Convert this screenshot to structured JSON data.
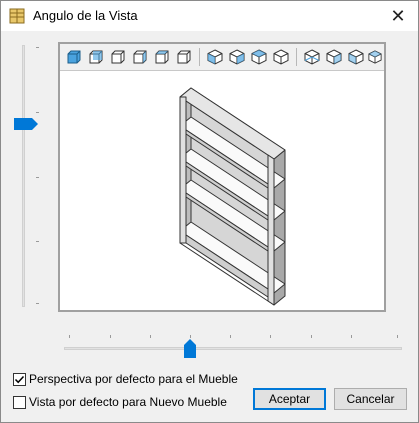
{
  "window": {
    "title": "Angulo de la Vista",
    "close_glyph": "✕"
  },
  "toolbar": {
    "icons": [
      "cube-view-icon-1",
      "cube-view-icon-2",
      "cube-view-icon-3",
      "cube-view-icon-4",
      "cube-view-icon-5",
      "cube-view-icon-6",
      "cube-iso-icon-1",
      "cube-iso-icon-2",
      "cube-iso-icon-3",
      "cube-iso-icon-4",
      "cube-iso-icon-5",
      "cube-iso-icon-6",
      "cube-iso-icon-7",
      "cube-iso-icon-8"
    ]
  },
  "options": {
    "perspective_label": "Perspectiva por defecto para el Mueble",
    "perspective_checked": true,
    "new_furniture_label": "Vista por defecto para Nuevo Mueble",
    "new_furniture_checked": false
  },
  "buttons": {
    "accept_label": "Aceptar",
    "cancel_label": "Cancelar"
  },
  "colors": {
    "accent": "#0078d7",
    "thumb": "#0078d7",
    "shelf_face": "#ffffff",
    "shelf_side": "#c8c8c8",
    "icon_fill": "#4aa3df"
  }
}
